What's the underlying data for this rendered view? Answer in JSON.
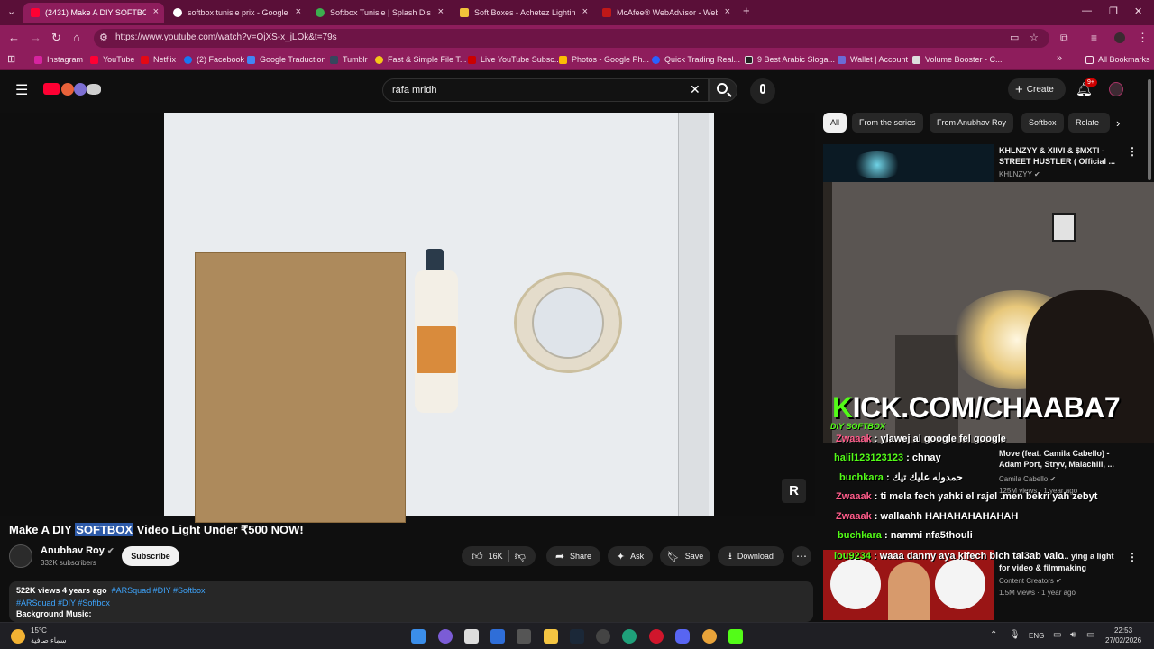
{
  "browser": {
    "tabs": [
      {
        "label": "(2431) Make A DIY SOFTBO",
        "active": true
      },
      {
        "label": "softbox tunisie prix - Google S"
      },
      {
        "label": "Softbox Tunisie | Splash Distrib"
      },
      {
        "label": "Soft Boxes - Achetez Lighting S"
      },
      {
        "label": "McAfee® WebAdvisor - Websi"
      }
    ],
    "url": "https://www.youtube.com/watch?v=OjXS-x_jLOk&t=79s",
    "bookmarks": [
      "Instagram",
      "YouTube",
      "Netflix",
      "(2) Facebook",
      "Google Traduction",
      "Tumblr",
      "Fast & Simple File T...",
      "Live YouTube Subsc...",
      "Photos - Google Ph...",
      "Quick Trading Real...",
      "9 Best Arabic Sloga...",
      "Wallet | Account",
      "Volume Booster - C..."
    ],
    "all_bookmarks": "All Bookmarks"
  },
  "youtube": {
    "search_value": "rafa mridh",
    "create_label": "Create",
    "notif_badge": "9+",
    "video_watermark": "R"
  },
  "video": {
    "title_before": "Make A DIY ",
    "title_highlight": "SOFTBOX",
    "title_after": " Video Light Under ₹500 NOW!",
    "channel": "Anubhav Roy",
    "subscribers": "332K subscribers",
    "subscribe": "Subscribe",
    "likes": "16K",
    "share": "Share",
    "ask": "Ask",
    "save": "Save",
    "download": "Download",
    "views_age": "522K views  4 years ago",
    "title_tags": "#ARSquad #DIY #Softbox",
    "desc_tags": "#ARSquad #DIY #Softbox",
    "desc_music": "Background Music:"
  },
  "chips": [
    "All",
    "From the series",
    "From Anubhav Roy",
    "Softbox",
    "Relate"
  ],
  "related": [
    {
      "title1": "KHLNZYY & XIIVI & $MXTI -",
      "title2": "STREET HUSTLER ( Official ...",
      "channel": "KHLNZYY"
    },
    {
      "title1": "Move (feat. Camila Cabello) -",
      "title2": "Adam Port, Stryv, Malachiii, ...",
      "channel": "Camila Cabello",
      "meta": "125M views · 1 year ago"
    },
    {
      "title1": "... ying a light",
      "title2": "for video & filmmaking",
      "channel": "Content Creators",
      "meta": "1.5M views · 1 year ago"
    }
  ],
  "stream": {
    "kick_k": "K",
    "kick_rest": "ICK.COM/CHAABA7",
    "overlay": "DIY SOFTBOX",
    "chat": [
      {
        "user": "Zwaaak",
        "msg": " : ylawej al google fel google"
      },
      {
        "user": "halil123123123",
        "msg": " : chnay"
      },
      {
        "user": "buchkara",
        "msg": " : حمدوله عليك تيك"
      },
      {
        "user": "Zwaaak",
        "msg": " : ti mela fech yahki el rajel .men bekri yah zebyt"
      },
      {
        "user": "Zwaaak",
        "msg": " : wallaahh HAHAHAHAHAHAH"
      },
      {
        "user": "buchkara",
        "msg": " : nammi nfa5thouli"
      },
      {
        "user": "lou9234",
        "msg": " : waaa danny aya kifech bich tal3ab valo"
      }
    ]
  },
  "taskbar": {
    "temp": "15°C",
    "weather": "سماء صافية",
    "lang": "ENG",
    "time": "22:53",
    "date": "27/02/2026"
  },
  "colors": {
    "tab_strip": "#5a0f38",
    "chrome_bar": "#8e1d5c",
    "yt_bg": "#0f0f0f",
    "kick_green": "#53fc18"
  }
}
